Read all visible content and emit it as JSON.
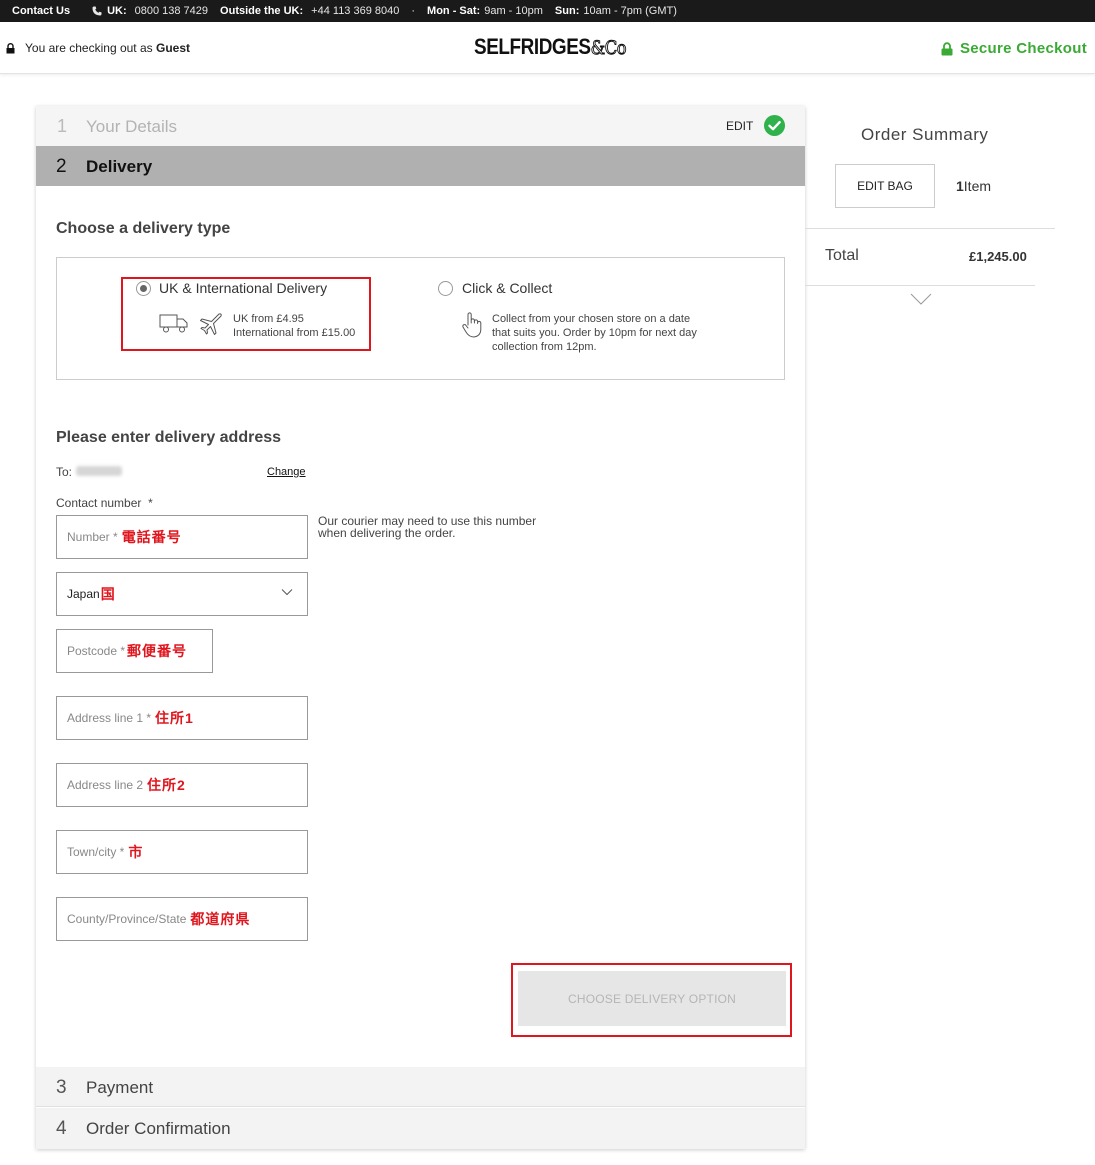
{
  "topbar": {
    "contact": "Contact Us",
    "uk_label": "UK:",
    "uk_phone": "0800 138 7429",
    "outside_label": "Outside the UK:",
    "outside_phone": "+44 113 369 8040",
    "dot": "·",
    "monsat_label": "Mon - Sat:",
    "monsat_hours": "9am - 10pm",
    "sun_label": "Sun:",
    "sun_hours": "10am - 7pm (GMT)"
  },
  "header": {
    "guest_prefix": "You are checking out as",
    "guest_name": "Guest",
    "logo_main": "SELFRIDGES",
    "logo_amp": "&Co",
    "secure": "Secure Checkout",
    "secure_color": "#3aaa35"
  },
  "steps": {
    "s1": {
      "num": "1",
      "label": "Your Details",
      "edit": "EDIT"
    },
    "s2": {
      "num": "2",
      "label": "Delivery"
    },
    "s3": {
      "num": "3",
      "label": "Payment"
    },
    "s4": {
      "num": "4",
      "label": "Order Confirmation"
    }
  },
  "delivery": {
    "heading": "Choose a delivery type",
    "uk": {
      "title": "UK & International Delivery",
      "line1": "UK from £4.95",
      "line2": "International from £15.00",
      "selected": true
    },
    "collect": {
      "title": "Click & Collect",
      "line1": "Collect from your chosen store on a date",
      "line2": "that suits you. Order by 10pm for next day",
      "line3": "collection from 12pm.",
      "selected": false
    }
  },
  "address": {
    "heading": "Please enter delivery address",
    "to_label": "To:",
    "change": "Change",
    "contact_label": "Contact number",
    "contact_star": "*",
    "courier_note": "Our courier may need to use this number when delivering the order.",
    "number": {
      "placeholder": "Number *",
      "annotation": "電話番号"
    },
    "country": {
      "value": "Japan",
      "annotation": "国"
    },
    "postcode": {
      "placeholder": "Postcode *",
      "annotation": "郵便番号"
    },
    "address1": {
      "placeholder": "Address line 1 *",
      "annotation": "住所1"
    },
    "address2": {
      "placeholder": "Address line 2",
      "annotation": "住所2"
    },
    "town": {
      "placeholder": "Town/city *",
      "annotation": "市"
    },
    "county": {
      "placeholder": "County/Province/State",
      "annotation": "都道府県"
    },
    "cta": "CHOOSE DELIVERY OPTION"
  },
  "summary": {
    "title": "Order Summary",
    "edit_bag": "EDIT BAG",
    "item_count": "1",
    "item_word": "Item",
    "total_label": "Total",
    "total_value": "£1,245.00"
  },
  "colors": {
    "annotation_red": "#e0161e",
    "success_green": "#2fb24c",
    "active_step_bg": "#b0b0b0"
  }
}
